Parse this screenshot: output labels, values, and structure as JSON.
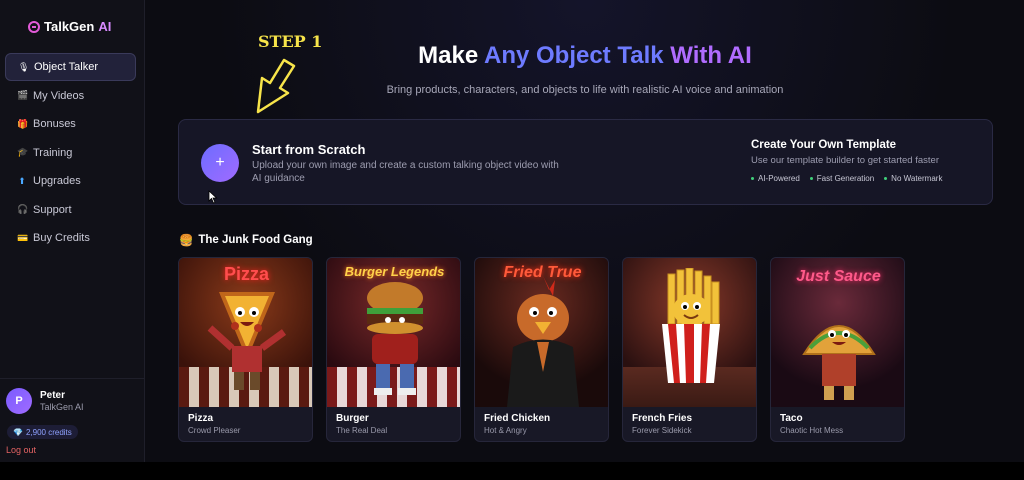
{
  "app": {
    "logo_name": "TalkGen",
    "logo_ai": "AI"
  },
  "sidebar": {
    "items": [
      {
        "label": "Object Talker",
        "icon": "microphone-icon",
        "active": true
      },
      {
        "label": "My Videos",
        "icon": "film-icon",
        "active": false
      },
      {
        "label": "Bonuses",
        "icon": "gift-icon",
        "active": false
      },
      {
        "label": "Training",
        "icon": "graduation-icon",
        "active": false
      },
      {
        "label": "Upgrades",
        "icon": "arrow-up-icon",
        "active": false
      },
      {
        "label": "Support",
        "icon": "headset-icon",
        "active": false
      },
      {
        "label": "Buy Credits",
        "icon": "credit-card-icon",
        "active": false
      }
    ],
    "user": {
      "initial": "P",
      "name": "Peter",
      "plan": "TalkGen AI",
      "credits": "2,900 credits"
    },
    "logout": "Log out"
  },
  "hero": {
    "title_part1": "Make ",
    "title_part2": "Any Object Talk ",
    "title_part3": "With AI",
    "subtitle": "Bring products, characters, and objects to life with realistic AI voice and animation"
  },
  "annotation": {
    "step": "STEP 1"
  },
  "scratch": {
    "title": "Start from Scratch",
    "description": "Upload your own image and create a custom talking object video with AI guidance",
    "template_title": "Create Your Own Template",
    "template_desc": "Use our template builder to get started faster",
    "tags": [
      "AI-Powered",
      "Fast Generation",
      "No Watermark"
    ]
  },
  "gallery": {
    "title": "The Junk Food Gang",
    "cards": [
      {
        "name": "Pizza",
        "sub": "Crowd Pleaser",
        "sign": "Pizza"
      },
      {
        "name": "Burger",
        "sub": "The Real Deal",
        "sign": "Burger Legends"
      },
      {
        "name": "Fried Chicken",
        "sub": "Hot & Angry",
        "sign": "Fried True"
      },
      {
        "name": "French Fries",
        "sub": "Forever Sidekick",
        "sign": ""
      },
      {
        "name": "Taco",
        "sub": "Chaotic Hot Mess",
        "sign": "Just Sauce"
      }
    ]
  },
  "colors": {
    "accent": "#6e7bff",
    "accent2": "#b06cff",
    "step": "#f7e44a",
    "logout": "#e46363"
  }
}
